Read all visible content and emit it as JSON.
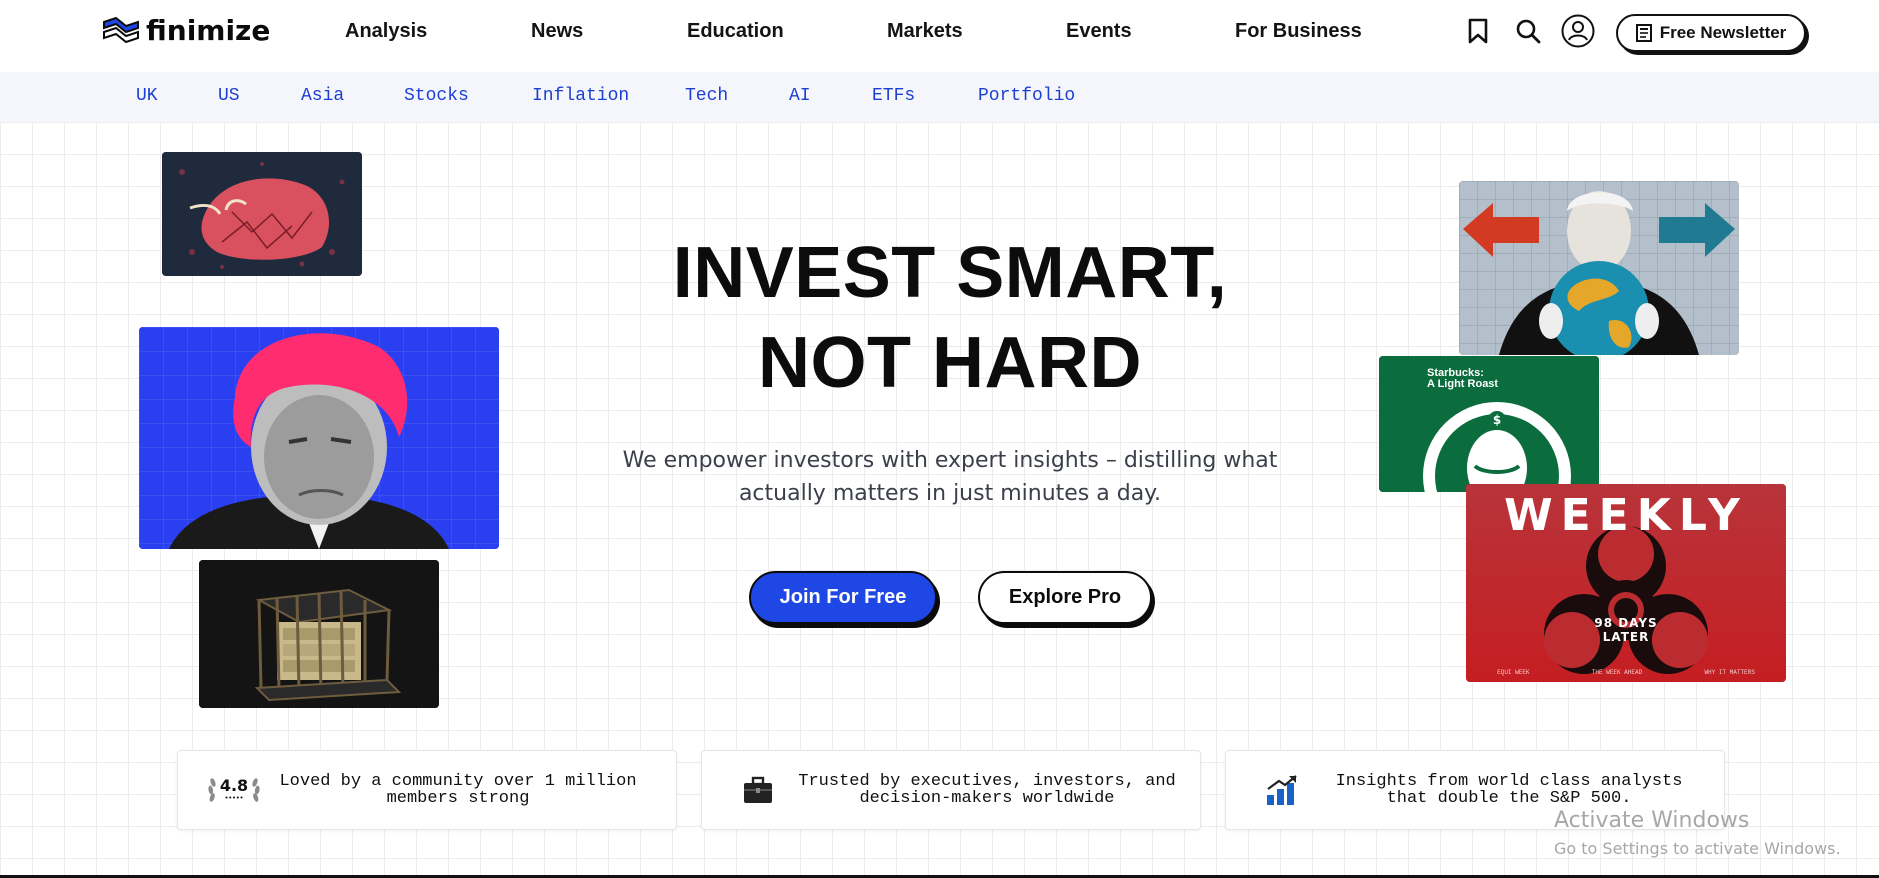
{
  "brand": {
    "name": "finimize"
  },
  "nav": {
    "items": [
      "Analysis",
      "News",
      "Education",
      "Markets",
      "Events",
      "For Business"
    ],
    "newsletter_label": "Free Newsletter"
  },
  "subnav": {
    "items": [
      "UK",
      "US",
      "Asia",
      "Stocks",
      "Inflation",
      "Tech",
      "AI",
      "ETFs",
      "Portfolio"
    ]
  },
  "hero": {
    "headline_line1": "INVEST SMART,",
    "headline_line2": "NOT HARD",
    "subtitle": "We empower investors with expert insights – distilling what actually matters in just minutes a day.",
    "primary_cta": "Join For Free",
    "secondary_cta": "Explore Pro"
  },
  "thumbnails": {
    "starbucks_caption": "Starbucks:\nA Light Roast",
    "weekly_title": "WEEKLY",
    "weekly_subtitle": "98 DAYS LATER",
    "weekly_footer": [
      "EQUI WEEK",
      "THE WEEK AHEAD",
      "WHY IT MATTERS"
    ]
  },
  "trust": [
    {
      "badge": "4.8",
      "text": "Loved by a community over 1 million members strong",
      "icon": "laurel-rating-icon"
    },
    {
      "text": "Trusted by executives, investors, and decision-makers worldwide",
      "icon": "briefcase-icon"
    },
    {
      "text": "Insights from world class analysts that double the S&P 500.",
      "icon": "growth-chart-icon"
    }
  ],
  "watermark": {
    "line1": "Activate Windows",
    "line2": "Go to Settings to activate Windows."
  },
  "colors": {
    "accent": "#1f47e6",
    "subnav_link": "#1d3fd1",
    "subnav_bg": "#f4f6fb"
  }
}
